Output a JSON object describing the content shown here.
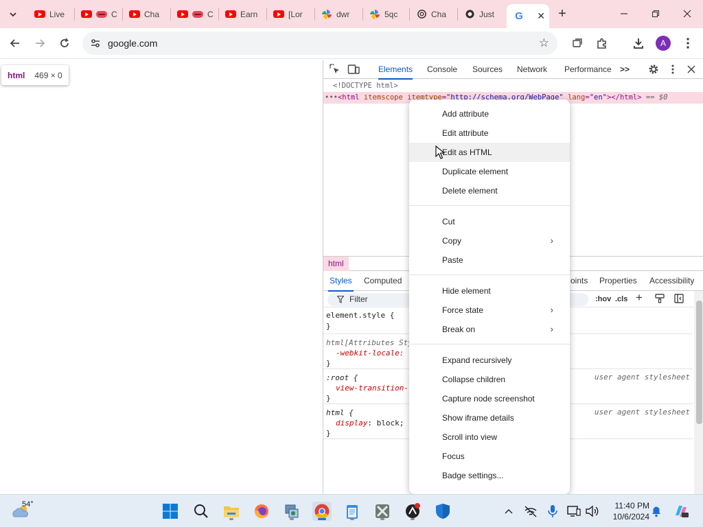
{
  "browser": {
    "tabs": [
      {
        "label": "Live",
        "favicon": "youtube-icon"
      },
      {
        "label": "C",
        "favicon": "lips-icon"
      },
      {
        "label": "Cha",
        "favicon": "youtube-icon"
      },
      {
        "label": "C",
        "favicon": "lips-icon"
      },
      {
        "label": "Earn",
        "favicon": "youtube-icon"
      },
      {
        "label": "[Lor",
        "favicon": "youtube-icon"
      },
      {
        "label": "dwr",
        "favicon": "pinwheel-icon"
      },
      {
        "label": "5qc",
        "favicon": "pinwheel-icon"
      },
      {
        "label": "Cha",
        "favicon": "openai-icon"
      },
      {
        "label": "Just",
        "favicon": "openai-icon"
      },
      {
        "label": "",
        "favicon": "google-icon",
        "active": true
      }
    ],
    "new_tab": "+",
    "address": "google.com",
    "avatar_letter": "A"
  },
  "page": {
    "tooltip_tag": "html",
    "tooltip_dims": "469 × 0"
  },
  "devtools": {
    "tabs": [
      "Elements",
      "Console",
      "Sources",
      "Network",
      "Performance"
    ],
    "more": ">>",
    "dom": {
      "doctype": "<!DOCTYPE html>",
      "html_open": "<html",
      "attr1_name": "itemscope",
      "attr2_name": "itemtype",
      "attr2_val": "\"http://schema.org/WebPage\"",
      "attr3_name": "lang",
      "attr3_val": "\"en\"",
      "html_close": "></html>",
      "eq": "== $0",
      "ellipsis": "•••"
    },
    "breadcrumb": "html",
    "style_tabs": [
      "Styles",
      "Computed",
      "oints",
      "Properties",
      "Accessibility"
    ],
    "filter_label": "Filter",
    "filter_buttons": [
      ":hov",
      ".cls"
    ],
    "rules": [
      {
        "line1": "element.style {",
        "line2": "}"
      },
      {
        "line1": "html[Attributes Sty",
        "line2": "-webkit-locale:",
        "line3": "}"
      },
      {
        "line1": ":root {",
        "line2": "view-transition-",
        "line3": "}",
        "source": "user agent stylesheet"
      },
      {
        "line1": "html {",
        "prop": "display",
        "value": "block;",
        "line3": "}",
        "source": "user agent stylesheet"
      }
    ]
  },
  "context_menu": {
    "items": [
      {
        "label": "Add attribute"
      },
      {
        "label": "Edit attribute"
      },
      {
        "label": "Edit as HTML",
        "hover": true
      },
      {
        "label": "Duplicate element"
      },
      {
        "label": "Delete element"
      },
      {
        "label": "Cut"
      },
      {
        "label": "Copy",
        "submenu": true
      },
      {
        "label": "Paste"
      },
      {
        "label": "Hide element"
      },
      {
        "label": "Force state",
        "submenu": true
      },
      {
        "label": "Break on",
        "submenu": true
      },
      {
        "label": "Expand recursively"
      },
      {
        "label": "Collapse children"
      },
      {
        "label": "Capture node screenshot"
      },
      {
        "label": "Show iframe details"
      },
      {
        "label": "Scroll into view"
      },
      {
        "label": "Focus"
      },
      {
        "label": "Badge settings..."
      }
    ],
    "submenu_arrow": "›"
  },
  "taskbar": {
    "weather_temp": "54°",
    "time": "11:40 PM",
    "date": "10/6/2024",
    "apps": [
      "windows-start-icon",
      "search-icon",
      "file-explorer-icon",
      "firefox-icon",
      "network-app-icon",
      "chrome-icon",
      "notepad-icon",
      "app-icon",
      "recorder-icon",
      "defender-icon"
    ]
  },
  "colors": {
    "tabstrip_bg": "#f9dde3",
    "accent_blue": "#0b57d0",
    "selected_row": "#fbd9e3",
    "html_tag": "#881280"
  }
}
